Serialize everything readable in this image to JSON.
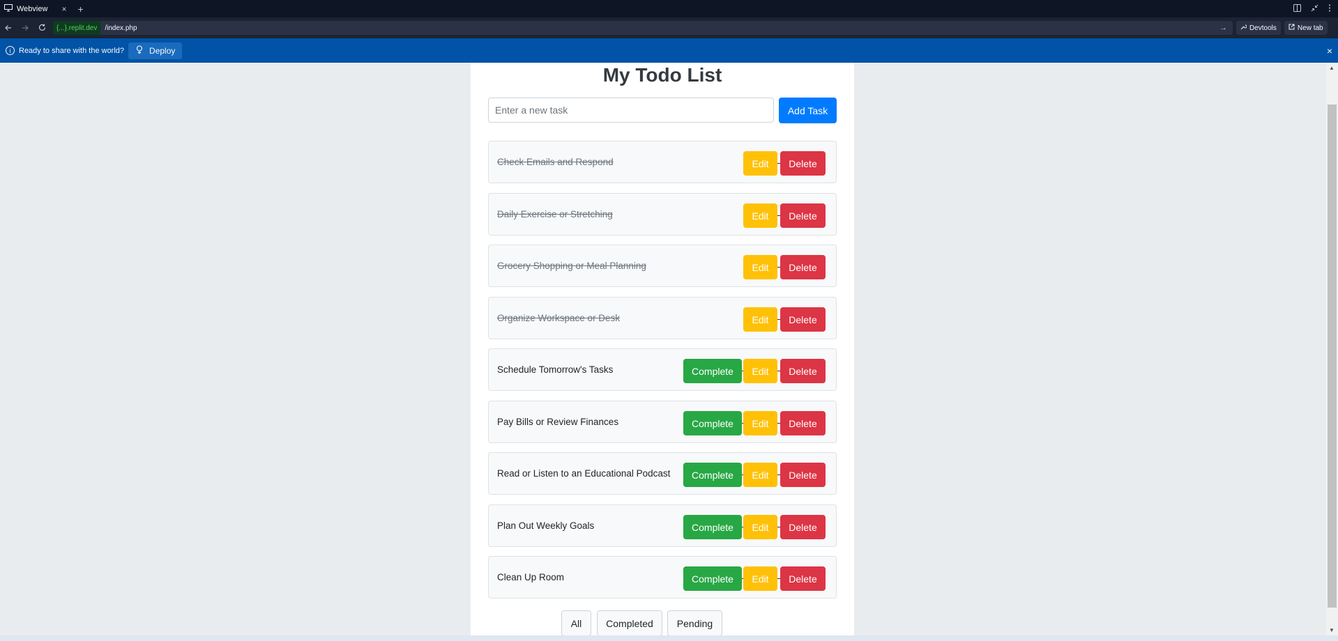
{
  "browser": {
    "tab_title": "Webview",
    "tab_close": "×",
    "tab_add": "+",
    "domain": "{...}.replit.dev",
    "path": "/index.php",
    "devtools_label": "Devtools",
    "new_tab_label": "New tab"
  },
  "banner": {
    "message": "Ready to share with the world?",
    "deploy_label": "Deploy",
    "close": "×"
  },
  "app": {
    "title": "My Todo List",
    "input_placeholder": "Enter a new task",
    "add_label": "Add Task",
    "complete_label": "Complete",
    "edit_label": "Edit",
    "delete_label": "Delete",
    "tasks": [
      {
        "text": "Check Emails and Respond",
        "completed": true
      },
      {
        "text": "Daily Exercise or Stretching",
        "completed": true
      },
      {
        "text": "Grocery Shopping or Meal Planning",
        "completed": true
      },
      {
        "text": "Organize Workspace or Desk",
        "completed": true
      },
      {
        "text": "Schedule Tomorrow's Tasks",
        "completed": false
      },
      {
        "text": "Pay Bills or Review Finances",
        "completed": false
      },
      {
        "text": "Read or Listen to an Educational Podcast",
        "completed": false
      },
      {
        "text": "Plan Out Weekly Goals",
        "completed": false
      },
      {
        "text": "Clean Up Room",
        "completed": false
      }
    ],
    "filters": [
      "All",
      "Completed",
      "Pending"
    ]
  }
}
